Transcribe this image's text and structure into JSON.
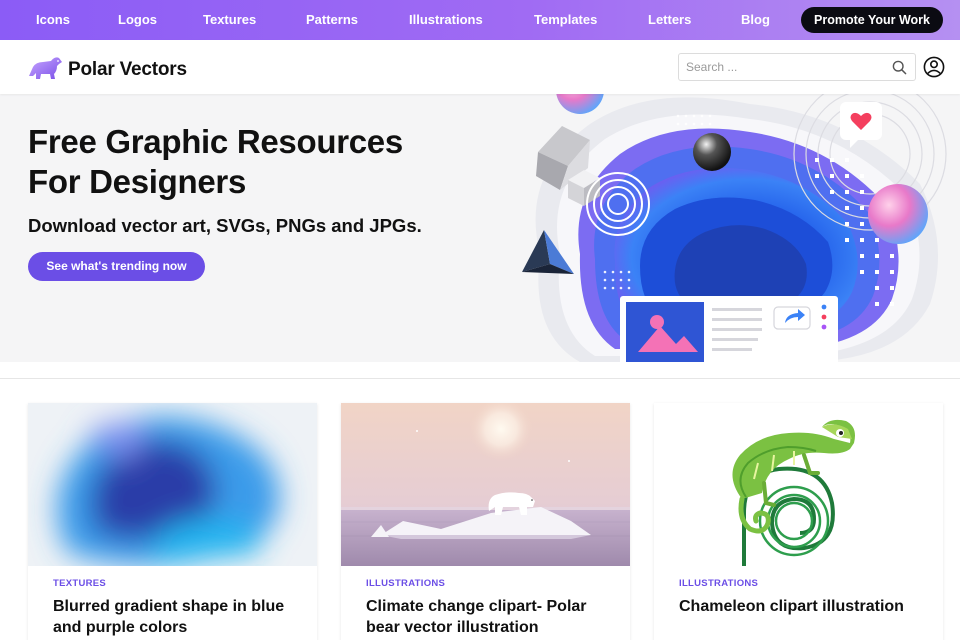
{
  "nav": {
    "items": [
      {
        "label": "Icons"
      },
      {
        "label": "Logos"
      },
      {
        "label": "Textures"
      },
      {
        "label": "Patterns"
      },
      {
        "label": "Illustrations"
      },
      {
        "label": "Templates"
      },
      {
        "label": "Letters"
      },
      {
        "label": "Blog"
      }
    ],
    "promote_label": "Promote Your Work"
  },
  "header": {
    "logo_text": "Polar Vectors",
    "logo_icon": "polar-bear-icon",
    "search_placeholder": "Search ...",
    "search_icon": "search-icon",
    "account_icon": "user-account-icon"
  },
  "hero": {
    "title": "Free Graphic Resources\nFor Designers",
    "subtitle": "Download vector art, SVGs, PNGs and JPGs.",
    "cta_label": "See what's trending now"
  },
  "cards": [
    {
      "category": "TEXTURES",
      "title": "Blurred gradient shape in blue and purple colors"
    },
    {
      "category": "ILLUSTRATIONS",
      "title": "Climate change clipart- Polar bear vector illustration"
    },
    {
      "category": "ILLUSTRATIONS",
      "title": "Chameleon clipart illustration"
    }
  ],
  "colors": {
    "nav_gradient_start": "#8b5cf6",
    "nav_gradient_end": "#b590f2",
    "accent": "#6b4ee6",
    "promote_bg": "#0b0b12"
  }
}
